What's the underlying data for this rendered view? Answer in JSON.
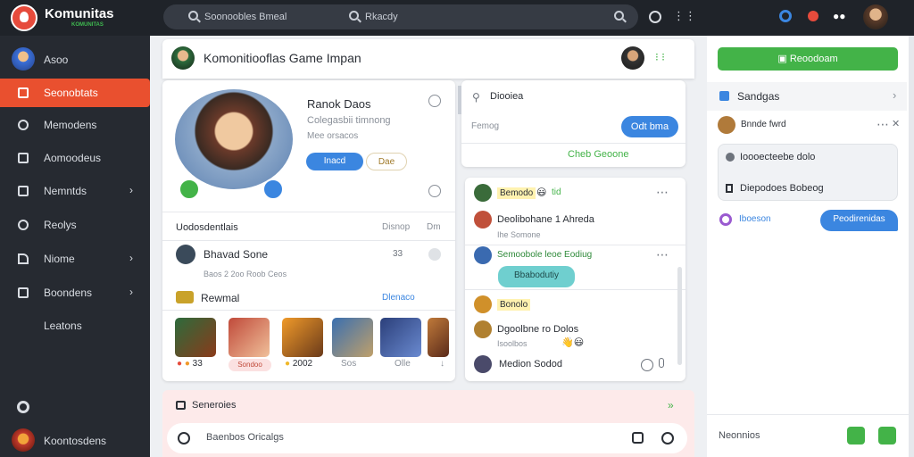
{
  "app": {
    "name": "Komunitas",
    "tagline": "KOMUNITAS"
  },
  "search": {
    "placeholder": "Soonoobles Bmeal",
    "secondary": "Rkacdy"
  },
  "sidebar": {
    "profile_label": "Asoo",
    "items": [
      {
        "label": "Seonobtats"
      },
      {
        "label": "Memodens"
      },
      {
        "label": "Aomoodeus"
      },
      {
        "label": "Nemntds"
      },
      {
        "label": "Reolys"
      },
      {
        "label": "Niome"
      },
      {
        "label": "Boondens"
      },
      {
        "label": "Leatons"
      }
    ],
    "footer_label": "Koontosdens"
  },
  "header": {
    "title": "Komonitiooflas Game Impan"
  },
  "profile": {
    "name": "Ranok Daos",
    "subtitle": "Colegasbii timnong",
    "meta": "Mee orsacos",
    "primary_btn": "Inacd",
    "secondary_btn": "Dae"
  },
  "sections": {
    "header_title": "Uodosdentlais",
    "header_a": "Disnop",
    "header_b": "Dm",
    "row_title": "Bhavad Sone",
    "row_sub": "Baos 2 2oo Roob Ceos",
    "row_count": "33",
    "row2_title": "Rewmal",
    "row2_link": "Dlenaco",
    "thumbs": [
      {
        "caption": "33"
      },
      {
        "caption": "Sondoo"
      },
      {
        "caption": "2002"
      },
      {
        "caption": "Sos"
      },
      {
        "caption": "Olle"
      },
      {
        "caption": ""
      }
    ]
  },
  "discover": {
    "title": "Diooiea",
    "input_placeholder": "Femog",
    "button": "Odt bma",
    "link": "Cheb Geoone"
  },
  "feed": {
    "items": [
      {
        "name": "Bemodo",
        "emoji": "😃",
        "extra": "tid"
      },
      {
        "name": "Deolibohane 1 Ahreda",
        "sub": "Ihe Somone"
      },
      {
        "name": "Semoobole leoe Eodiug",
        "bubble": "Bbabodutiy"
      },
      {
        "name": "Bonolo"
      },
      {
        "name": "Dgoolbne ro Dolos",
        "sub": "Isoolbos",
        "reactions": "👋😃"
      },
      {
        "name": "Medion Sodod"
      }
    ]
  },
  "composer": {
    "title": "Seneroies",
    "placeholder": "Baenbos Oricalgs"
  },
  "right": {
    "cta": "Reoodoam",
    "section_title": "Sandgas",
    "chat_name": "Bnnde fwrd",
    "card_line1": "Ioooecteebe dolo",
    "card_line2": "Diepodoes Bobeog",
    "reply_name": "Iboeson",
    "reply_bubble": "Peodirenidas",
    "footer_label": "Neonnios"
  },
  "colors": {
    "accent": "#e9502f",
    "green": "#43b348",
    "blue": "#3b86e0",
    "teal": "#5ec8c7"
  }
}
